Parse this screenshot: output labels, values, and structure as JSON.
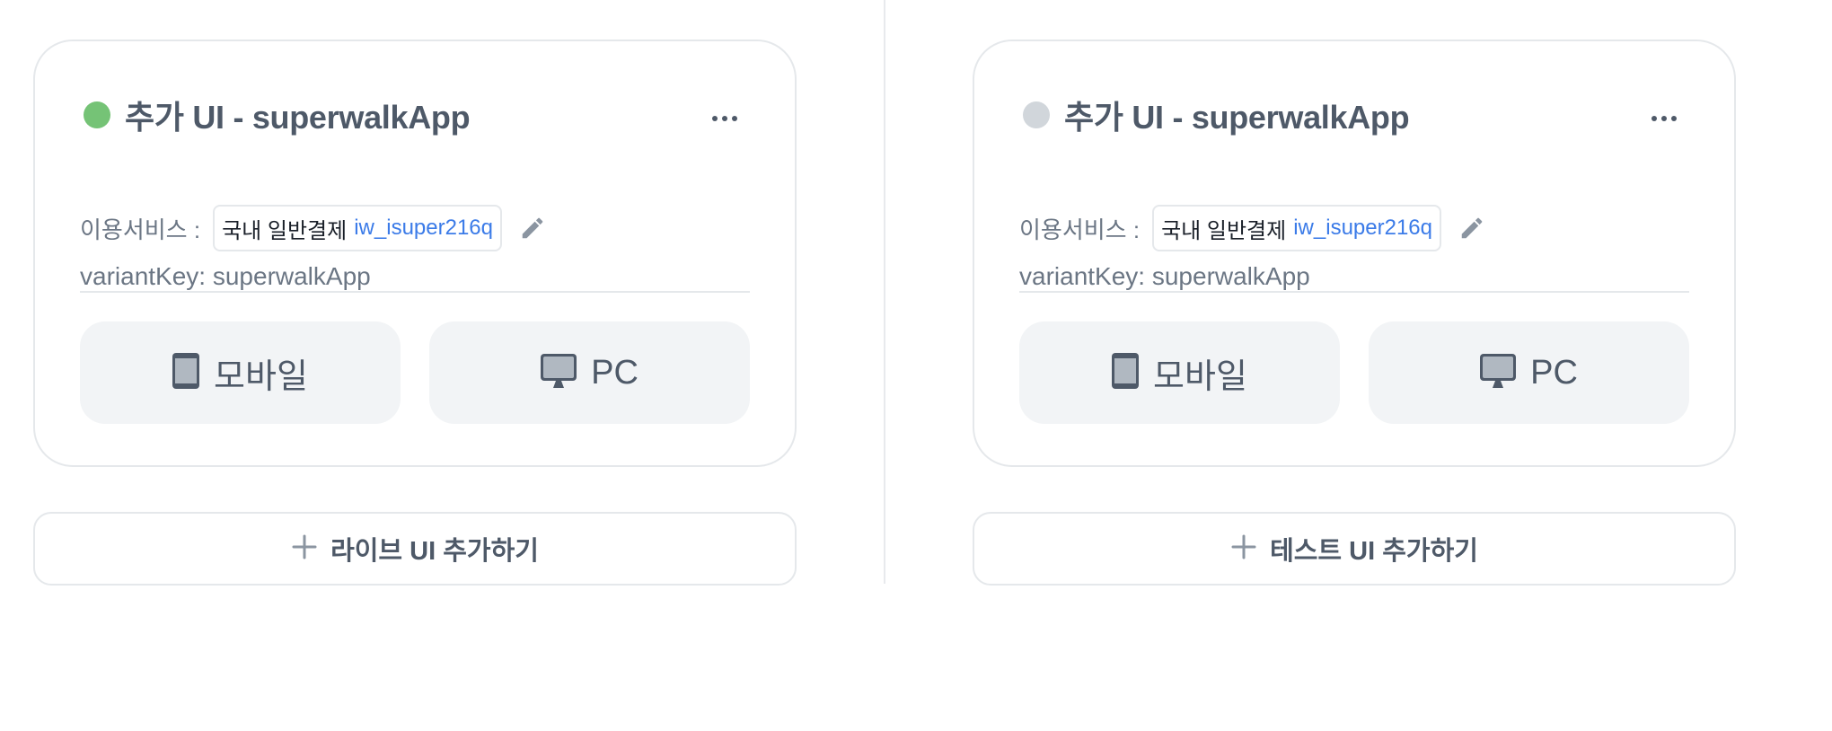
{
  "colors": {
    "active_status": "#75c376",
    "inactive_status": "#d1d6db",
    "link_blue": "#3b7be8",
    "text_gray": "#4e5968",
    "device_bg": "#f2f4f6"
  },
  "live": {
    "card": {
      "status": "active",
      "status_icon": "green-dot",
      "title": "추가 UI - superwalkApp",
      "more_icon": "more-horizontal-icon",
      "service_label": "이용서비스 :",
      "service_name": "국내 일반결제",
      "service_id": "iw_isuper216q",
      "edit_icon": "pencil-icon",
      "variant": "variantKey: superwalkApp",
      "devices": [
        {
          "label": "모바일",
          "icon": "mobile-icon"
        },
        {
          "label": "PC",
          "icon": "monitor-icon"
        }
      ]
    },
    "add_button": {
      "label": "라이브 UI 추가하기",
      "icon": "plus-icon"
    }
  },
  "test": {
    "card": {
      "status": "inactive",
      "status_icon": "gray-dot",
      "title": "추가 UI - superwalkApp",
      "more_icon": "more-horizontal-icon",
      "service_label": "이용서비스 :",
      "service_name": "국내 일반결제",
      "service_id": "iw_isuper216q",
      "edit_icon": "pencil-icon",
      "variant": "variantKey: superwalkApp",
      "devices": [
        {
          "label": "모바일",
          "icon": "mobile-icon"
        },
        {
          "label": "PC",
          "icon": "monitor-icon"
        }
      ]
    },
    "add_button": {
      "label": "테스트 UI 추가하기",
      "icon": "plus-icon"
    }
  }
}
